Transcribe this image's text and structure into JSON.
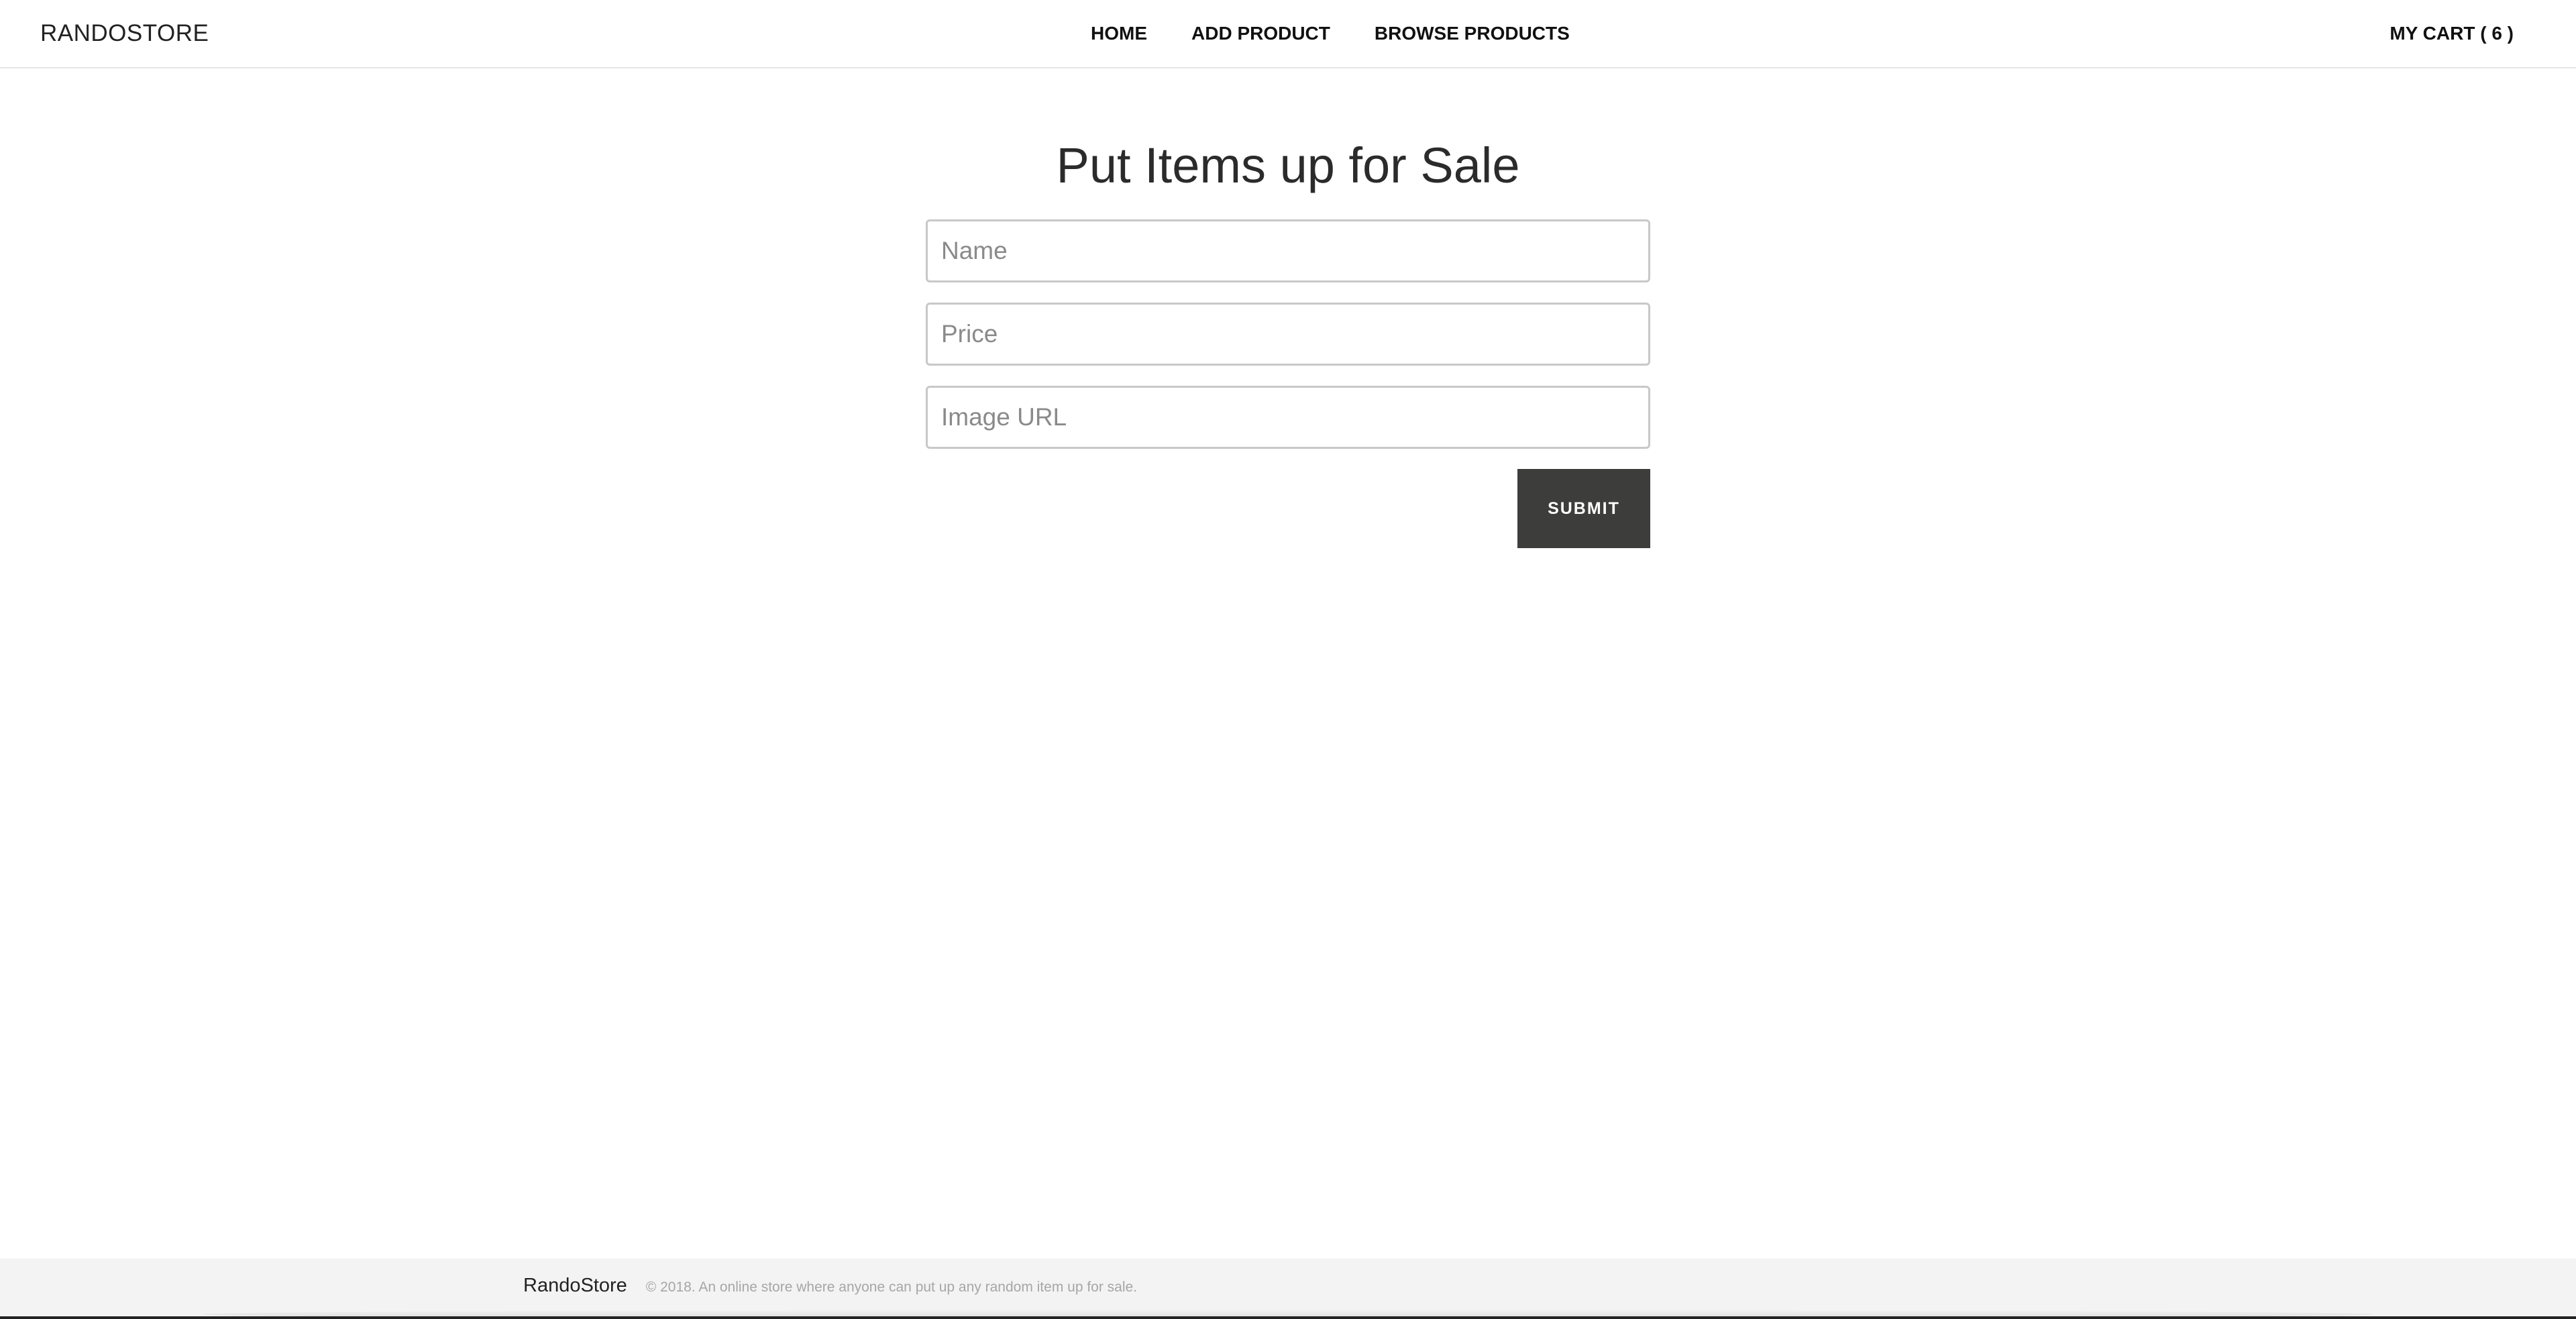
{
  "header": {
    "brand": "RANDOSTORE",
    "nav": [
      {
        "label": "HOME"
      },
      {
        "label": "ADD PRODUCT"
      },
      {
        "label": "BROWSE PRODUCTS"
      }
    ],
    "cart_label": "MY CART ( 6 )"
  },
  "main": {
    "title": "Put Items up for Sale",
    "form": {
      "name_placeholder": "Name",
      "price_placeholder": "Price",
      "image_url_placeholder": "Image URL",
      "submit_label": "SUBMIT"
    }
  },
  "footer": {
    "brand": "RandoStore",
    "text": "© 2018. An online store where anyone can put up any random item up for sale."
  },
  "colors": {
    "submit_background": "#3d3e3b",
    "footer_background": "#f3f3f3",
    "title_text": "#2b2b2b"
  }
}
